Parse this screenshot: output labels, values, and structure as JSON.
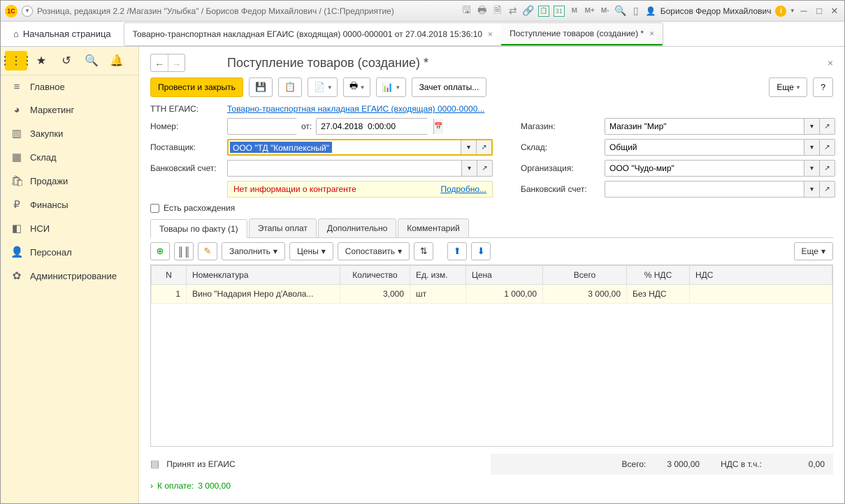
{
  "titlebar": {
    "logo": "1C",
    "title": "Розница, редакция 2.2 /Магазин \"Улыбка\" / Борисов Федор Михайлович /  (1С:Предприятие)",
    "cal": "31",
    "m": "M",
    "mplus": "M+",
    "mminus": "M-",
    "user": "Борисов Федор Михайлович"
  },
  "home_tab": "Начальная страница",
  "doc_tabs": [
    "Товарно-транспортная накладная ЕГАИС (входящая) 0000-000001 от 27.04.2018 15:36:10",
    "Поступление товаров (создание) *"
  ],
  "sidebar": [
    {
      "icon": "≡",
      "label": "Главное"
    },
    {
      "icon": "◕",
      "label": "Маркетинг"
    },
    {
      "icon": "▥",
      "label": "Закупки"
    },
    {
      "icon": "▦",
      "label": "Склад"
    },
    {
      "icon": "🛍",
      "label": "Продажи"
    },
    {
      "icon": "₽",
      "label": "Финансы"
    },
    {
      "icon": "◧",
      "label": "НСИ"
    },
    {
      "icon": "👤",
      "label": "Персонал"
    },
    {
      "icon": "✿",
      "label": "Администрирование"
    }
  ],
  "page_title": "Поступление товаров (создание) *",
  "toolbar": {
    "primary": "Провести и закрыть",
    "offset": "Зачет оплаты...",
    "more": "Еще",
    "help": "?"
  },
  "form": {
    "ttn_label": "ТТН ЕГАИС:",
    "ttn_link": "Товарно-транспортная накладная ЕГАИС (входящая) 0000-0000...",
    "number_label": "Номер:",
    "from_label": "от:",
    "date_value": "27.04.2018  0:00:00",
    "store_label": "Магазин:",
    "store_value": "Магазин \"Мир\"",
    "supplier_label": "Поставщик:",
    "supplier_value": "ООО \"ТД \"Комплексный\"",
    "warehouse_label": "Склад:",
    "warehouse_value": "Общий",
    "bank_label": "Банковский счет:",
    "org_label": "Организация:",
    "org_value": "ООО \"Чудо-мир\"",
    "bank2_label": "Банковский счет:",
    "warning": "Нет информации о контрагенте",
    "details_link": "Подробно...",
    "discrepancy": "Есть расхождения"
  },
  "tabs": [
    "Товары по факту (1)",
    "Этапы оплат",
    "Дополнительно",
    "Комментарий"
  ],
  "table_toolbar": {
    "fill": "Заполнить",
    "prices": "Цены",
    "compare": "Сопоставить",
    "more": "Еще"
  },
  "table": {
    "headers": [
      "N",
      "Номенклатура",
      "Количество",
      "Ед. изм.",
      "Цена",
      "Всего",
      "% НДС",
      "НДС"
    ],
    "rows": [
      {
        "n": "1",
        "nom": "Вино \"Надария Неро д'Авола...",
        "qty": "3,000",
        "unit": "шт",
        "price": "1 000,00",
        "total": "3 000,00",
        "vat_pct": "Без НДС",
        "vat": ""
      }
    ]
  },
  "status": "Принят из ЕГАИС",
  "totals": {
    "total_label": "Всего:",
    "total_value": "3 000,00",
    "vat_label": "НДС в т.ч.:",
    "vat_value": "0,00"
  },
  "pay": {
    "label": "К оплате:",
    "value": "3 000,00"
  }
}
